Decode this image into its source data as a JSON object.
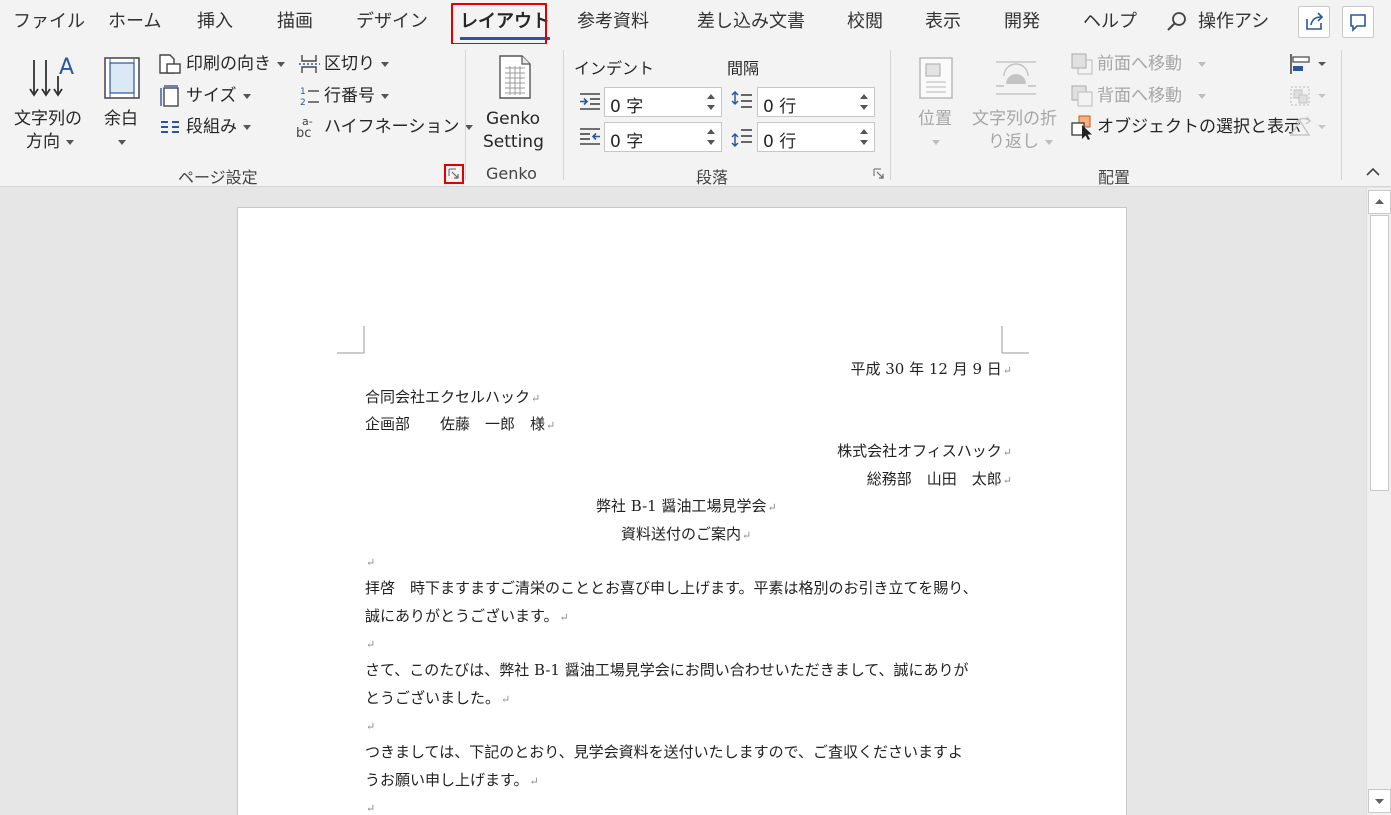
{
  "tabs": [
    {
      "label": "ファイル"
    },
    {
      "label": "ホーム"
    },
    {
      "label": "挿入"
    },
    {
      "label": "描画"
    },
    {
      "label": "デザイン"
    },
    {
      "label": "レイアウト"
    },
    {
      "label": "参考資料"
    },
    {
      "label": "差し込み文書"
    },
    {
      "label": "校閲"
    },
    {
      "label": "表示"
    },
    {
      "label": "開発"
    },
    {
      "label": "ヘルプ"
    }
  ],
  "tellme": {
    "label": "操作アシ"
  },
  "ribbon": {
    "page_setup": {
      "text_direction_line1": "文字列の",
      "text_direction_line2": "方向",
      "margins": "余白",
      "orientation": "印刷の向き",
      "size": "サイズ",
      "columns": "段組み",
      "breaks": "区切り",
      "line_numbers": "行番号",
      "hyphenation": "ハイフネーション",
      "group_label": "ページ設定"
    },
    "genko": {
      "button_line1": "Genko",
      "button_line2": "Setting",
      "group_label": "Genko"
    },
    "paragraph": {
      "indent_label": "インデント",
      "spacing_label": "間隔",
      "indent_left": "0 字",
      "indent_right": "0 字",
      "spacing_before": "0 行",
      "spacing_after": "0 行",
      "group_label": "段落"
    },
    "arrange": {
      "position": "位置",
      "wrap_line1": "文字列の折",
      "wrap_line2": "り返し",
      "bring_forward": "前面へ移動",
      "send_backward": "背面へ移動",
      "selection_pane": "オブジェクトの選択と表示",
      "group_label": "配置"
    }
  },
  "document": {
    "date": "平成 30 年 12 月 9 日",
    "recipient_company": "合同会社エクセルハック",
    "recipient_person": "企画部　　佐藤　一郎　様",
    "sender_company": "株式会社オフィスハック",
    "sender_person": "総務部　山田　太郎",
    "title1": "弊社 B-1 醤油工場見学会",
    "title2": "資料送付のご案内",
    "para1_line1": "拝啓　時下ますますご清栄のこととお喜び申し上げます。平素は格別のお引き立てを賜り、",
    "para1_line2": "誠にありがとうございます。",
    "para2_line1": "さて、このたびは、弊社 B-1 醤油工場見学会にお問い合わせいただきまして、誠にありが",
    "para2_line2": "とうございました。",
    "para3_line1": "つきましては、下記のとおり、見学会資料を送付いたしますので、ご査収くださいますよ",
    "para3_line2": "うお願い申し上げます。",
    "paragraph_mark": "↵"
  },
  "colors": {
    "accent": "#2b579a",
    "highlight": "#e00000",
    "ribbon_bg": "#f3f3f3",
    "doc_bg": "#e6e6e6"
  }
}
